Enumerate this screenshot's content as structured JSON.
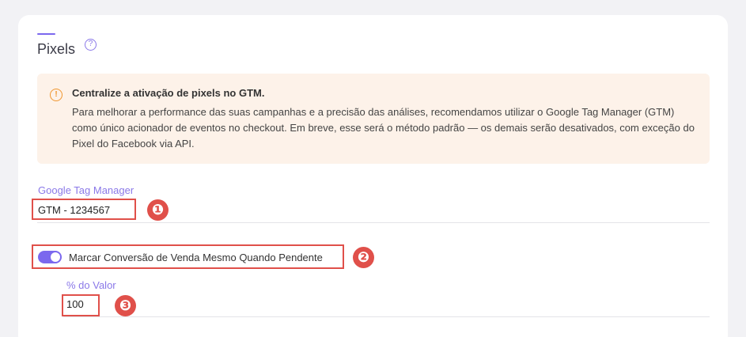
{
  "section": {
    "title": "Pixels",
    "help_icon": "question-circle-icon",
    "help_symbol": "?"
  },
  "alert": {
    "icon": "exclamation-circle-icon",
    "icon_symbol": "!",
    "title": "Centralize a ativação de pixels no GTM.",
    "text": "Para melhorar a performance das suas campanhas e a precisão das análises, recomendamos utilizar o Google Tag Manager (GTM) como único acionador de eventos no checkout. Em breve, esse será o método padrão — os demais serão desativados, com exceção do Pixel do Facebook via API."
  },
  "gtm": {
    "label": "Google Tag Manager",
    "value": "GTM - 1234567"
  },
  "conversion_toggle": {
    "label": "Marcar Conversão de Venda Mesmo Quando Pendente",
    "checked": true
  },
  "percent": {
    "label": "% do Valor",
    "value": "100"
  },
  "annotations": {
    "one": "❶",
    "two": "❷",
    "three": "❸"
  },
  "colors": {
    "accent": "#7b68ee",
    "alert_bg": "#fdf2e9",
    "alert_icon": "#f0962e",
    "annotation": "#e0504a"
  }
}
